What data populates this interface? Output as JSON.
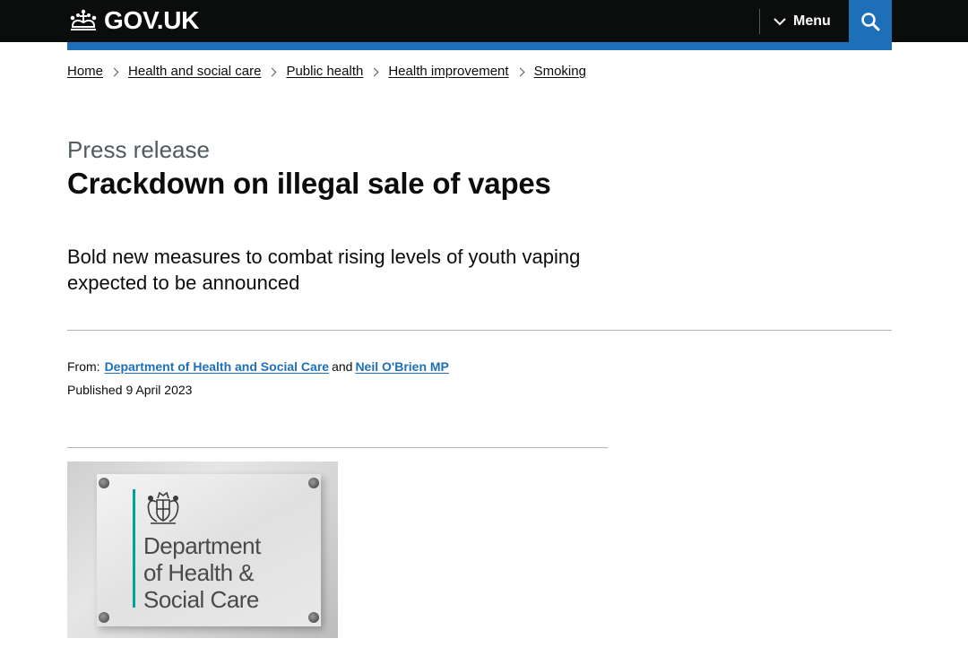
{
  "header": {
    "logo_text": "GOV.UK",
    "menu_label": "Menu",
    "accent_color": "#1d70b8",
    "background_color": "#0b0c0c",
    "icons": [
      "crown-icon",
      "chevron-down-icon",
      "search-icon"
    ]
  },
  "breadcrumbs": [
    {
      "label": "Home"
    },
    {
      "label": "Health and social care"
    },
    {
      "label": "Public health"
    },
    {
      "label": "Health improvement"
    },
    {
      "label": "Smoking"
    }
  ],
  "article": {
    "caption": "Press release",
    "title": "Crackdown on illegal sale of vapes",
    "lead": "Bold new measures to combat rising levels of youth vaping expected to be announced"
  },
  "metadata": {
    "from_label": "From:",
    "from_links": [
      "Department of Health and Social Care",
      "Neil O'Brien MP"
    ],
    "and_text": "and",
    "published_label": "Published",
    "published_date": "9 April 2023"
  },
  "image": {
    "plaque_lines": [
      "Department",
      "of Health &",
      "Social Care"
    ],
    "plaque_accent": "#00a398"
  }
}
